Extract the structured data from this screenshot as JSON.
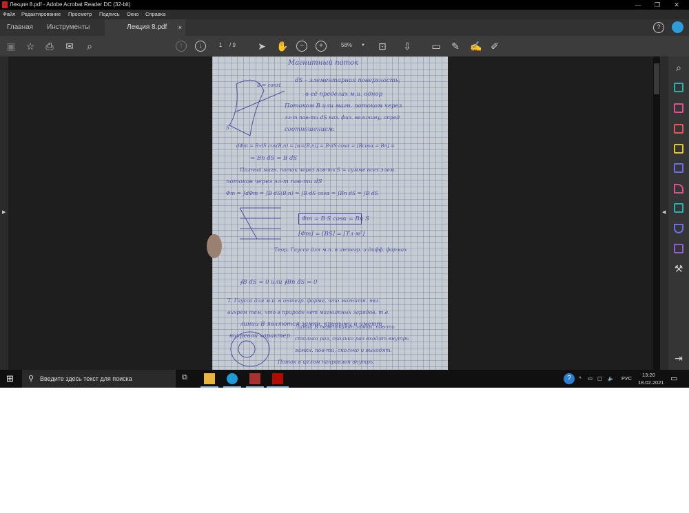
{
  "window": {
    "title": "Лекция 8.pdf - Adobe Acrobat Reader DC (32-bit)",
    "minimize": "—",
    "maximize": "❐",
    "close": "✕"
  },
  "menu": [
    "Файл",
    "Редактирование",
    "Просмотр",
    "Подпись",
    "Окно",
    "Справка"
  ],
  "tabs": {
    "home": "Главная",
    "tools": "Инструменты",
    "document": "Лекция 8.pdf",
    "close": "×"
  },
  "toolbar": {
    "page_current": "1",
    "page_total": "/ 9",
    "zoom": "58%"
  },
  "document_page": {
    "lines": [
      "Магнитный поток",
      "dS – элементарная поверхность;",
      "в её пределах м.и. однор",
      "Потоком B или магн. потоком через",
      "эл-т пов-ти dS наз. физ. величину, опред",
      "соотношением:",
      "dΦm = B·dS cos(B,n) = [α=(B,n)] = B·dS·cosα = [Bcosα = Bn] =",
      "= Bn dS = B dS",
      "Полный магн. поток через пов-ть S = сумме всех элем.",
      "потоков через эл-т пов-ти dS",
      "Φm = ∫dΦm = ∫B dS(B,n) = ∫B·dS cosα = ∫Bn dS = ∫B dS",
      "Φm = B·S cosα = Bn S",
      "[Φm] = [BS] = [Тл·м²]",
      "Теор. Гаусса для м.п. в интегр. и дифф. формах",
      "∮B dS = 0   или   ∮Bn dS = 0",
      "Т. Гаусса для м.п. в интегр. форме, что магнитн. явл.",
      "вихрем тем, что в природе нет магнитных зарядов, т.е.",
      "линии B являются замкн. кривыми и имеют",
      "вихревой характер.",
      "Линии B пересекают замкн. пов-ть",
      "столько раз, сколько раз входят внутрь",
      "замкн. пов-ти, сколько и выходят.",
      "Поток в целом направлен внутрь."
    ],
    "label_b_const": "B = const",
    "label_s": "S"
  },
  "taskbar": {
    "search_placeholder": "Введите здесь текст для поиска",
    "language": "РУС",
    "time": "13:20",
    "date": "18.02.2021"
  },
  "colors": {
    "accent": "#2d9cdb",
    "hand_tool": "#4aa3f0"
  }
}
